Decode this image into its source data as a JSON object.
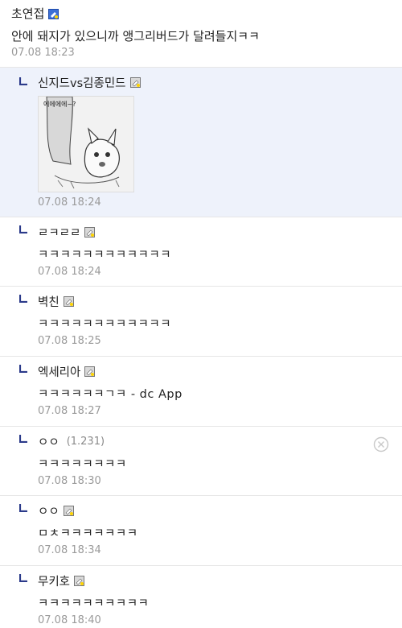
{
  "root": {
    "nick": "초연접",
    "text": "안에 돼지가 있으니까 앵그리버드가 달려들지ㅋㅋ",
    "time": "07.08 18:23"
  },
  "replies": [
    {
      "nick": "신지드vs김종민드",
      "image_text": "에에에에~?",
      "time": "07.08 18:24"
    },
    {
      "nick": "ㄹㅋㄹㄹ",
      "text": "ㅋㅋㅋㅋㅋㅋㅋㅋㅋㅋㅋㅋ",
      "time": "07.08 18:24"
    },
    {
      "nick": "벽친",
      "text": "ㅋㅋㅋㅋㅋㅋㅋㅋㅋㅋㅋㅋ",
      "time": "07.08 18:25"
    },
    {
      "nick": "엑세리아",
      "text": "ㅋㅋㅋㅋㅋㅋㄱㅋ - dc App",
      "time": "07.08 18:27"
    },
    {
      "nick": "ㅇㅇ",
      "ip": "(1.231)",
      "text": "ㅋㅋㅋㅋㅋㅋㅋㅋ",
      "time": "07.08 18:30"
    },
    {
      "nick": "ㅇㅇ",
      "text": "ㅁㅊㅋㅋㅋㅋㅋㅋㅋ",
      "time": "07.08 18:34"
    },
    {
      "nick": "무키호",
      "text": "ㅋㅋㅋㅋㅋㅋㅋㅋㅋㅋ",
      "time": "07.08 18:40"
    }
  ],
  "colors": {
    "highlight": "#eef2fb",
    "arrow": "#2b3a8a",
    "badge_blue": "#3b6fd6"
  }
}
